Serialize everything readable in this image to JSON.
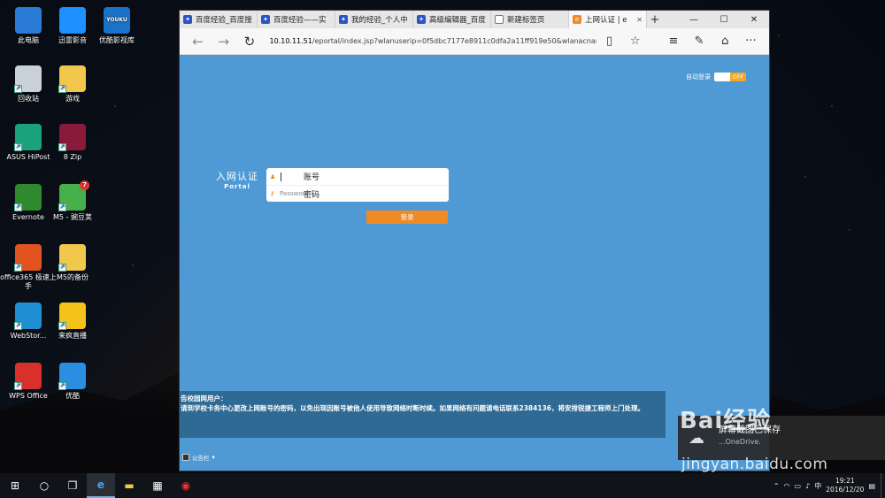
{
  "desktop": {
    "icons": [
      {
        "label": "此电脑",
        "icon": "computer-icon",
        "color": "#2a7bd5"
      },
      {
        "label": "迅雷影音",
        "icon": "xunlei-player-icon",
        "color": "#1e90ff"
      },
      {
        "label": "优酷影视库",
        "icon": "youku-icon",
        "color": "#1a73c8",
        "badge": "YOUKU"
      },
      {
        "label": "回收站",
        "icon": "recycle-bin-icon",
        "color": "#c8d0d8"
      },
      {
        "label": "游戏",
        "icon": "game-folder-icon",
        "color": "#f1c84b"
      },
      {
        "label": "ASUS HiPost",
        "icon": "asus-hipost-icon",
        "color": "#1aa37a"
      },
      {
        "label": "8 Zip",
        "icon": "8zip-icon",
        "color": "#8a1a3a"
      },
      {
        "label": "Evernote",
        "icon": "evernote-icon",
        "color": "#2f8a2f"
      },
      {
        "label": "M5 - 豌豆荚",
        "icon": "wandoujia-icon",
        "color": "#46b04a",
        "count": "7"
      },
      {
        "label": "office365 极速上手",
        "icon": "office365-icon",
        "color": "#e2531f"
      },
      {
        "label": "M5的备份",
        "icon": "backup-folder-icon",
        "color": "#f1c84b"
      },
      {
        "label": "WebStor...",
        "icon": "webstorage-icon",
        "color": "#1e8fd0"
      },
      {
        "label": "来疯直播",
        "icon": "laifeng-icon",
        "color": "#f4c21a"
      },
      {
        "label": "WPS Office",
        "icon": "wps-icon",
        "color": "#d9302c"
      },
      {
        "label": "优酷",
        "icon": "youku-play-icon",
        "color": "#2a8fe0"
      }
    ]
  },
  "browser": {
    "tabs": [
      {
        "label": "百度经验_百度搜",
        "favicon": "baidu"
      },
      {
        "label": "百度经验——实",
        "favicon": "baidu"
      },
      {
        "label": "我的经验_个人中",
        "favicon": "baidu"
      },
      {
        "label": "高级编辑器_百度",
        "favicon": "baidu"
      },
      {
        "label": "新建标签页",
        "favicon": "newtab"
      },
      {
        "label": "上网认证 | e",
        "favicon": "orange",
        "active": true
      }
    ],
    "url_host": "10.10.11.51",
    "url_path": "/eportal/index.jsp?wlanuserip=0f5dbc7177e8911c0dfa2a11ff919e50&wlanacname=dec5a4e"
  },
  "portal": {
    "auto_login_label": "自动登录",
    "toggle_state": "OFF",
    "title_cn": "入网认证",
    "title_en": "Portal",
    "account_value": "账号",
    "password_placeholder": "Password",
    "password_value": "密码",
    "login_label": "登录",
    "notice_heading": "告校园网用户：",
    "notice_body": "请到学校卡务中心更改上网账号的密码，以免出现因账号被他人使用导致网络时断时续。如果网络有问题请电话联系2384136，将安排锐捷工程师上门处理。",
    "notice_tab_label": "公告栏"
  },
  "toast": {
    "title": "屏幕截图已保存",
    "subtitle": "...OneDrive."
  },
  "watermark": {
    "text": "Bai经验",
    "url": "jingyan.baidu.com"
  },
  "taskbar": {
    "time": "19:21",
    "date": "2016/12/20",
    "ime": "中"
  }
}
